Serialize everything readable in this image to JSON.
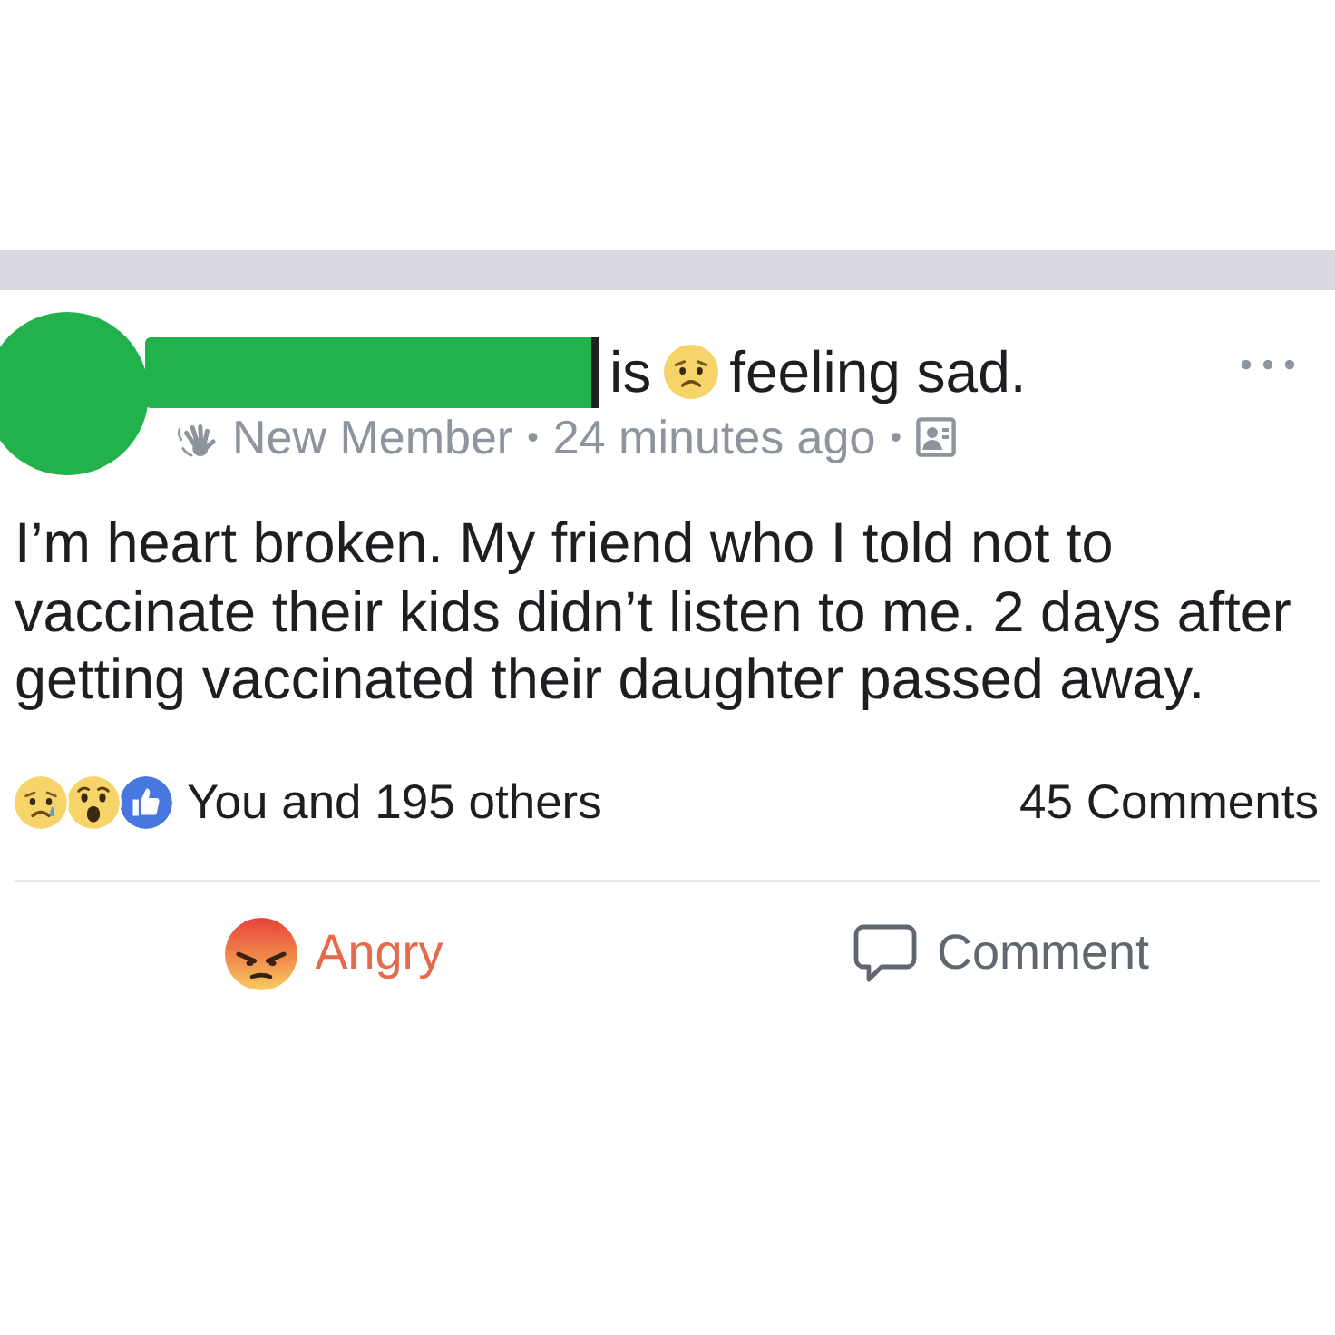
{
  "header": {
    "status_text": "is",
    "feeling": {
      "kind": "sad",
      "text": "feeling sad."
    },
    "meta": [
      {
        "kind": "badge",
        "text": "New Member"
      },
      {
        "kind": "separator",
        "text": "•"
      },
      {
        "kind": "time",
        "text": "24 minutes ago"
      },
      {
        "kind": "separator",
        "text": "•"
      },
      {
        "kind": "audience"
      }
    ]
  },
  "body": "I’m heart broken. My friend who I told not to vaccinate their kids didn’t listen to me. 2 days after getting vaccinated their daughter passed away.",
  "summary": {
    "reactions": [
      {
        "kind": "sad"
      },
      {
        "kind": "wow"
      },
      {
        "kind": "like"
      }
    ],
    "reaction_text": "You and 195 others",
    "comments_count": "45 Comments"
  },
  "actions": [
    {
      "kind": "angry",
      "label": "Angry",
      "selected": true
    },
    {
      "kind": "comment",
      "label": "Comment",
      "selected": false
    }
  ]
}
